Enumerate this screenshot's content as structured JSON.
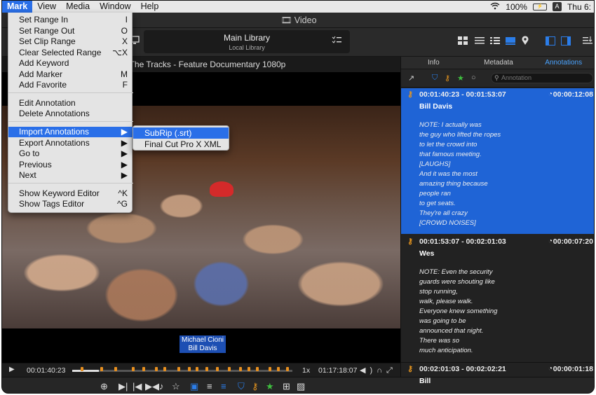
{
  "menubar": {
    "items": [
      "Mark",
      "View",
      "Media",
      "Window",
      "Help"
    ],
    "battery": "100%",
    "input_source": "A",
    "clock": "Thu 6:"
  },
  "window": {
    "title": "Video"
  },
  "toolbar": {
    "library_title": "Main Library",
    "library_subtitle": "Local Library"
  },
  "viewer": {
    "clip_title": "ff The Tracks - Feature Documentary 1080p",
    "lower_third": [
      "Michael Cioni",
      "Bill Davis"
    ]
  },
  "transport": {
    "current_timecode": "00:01:40:23",
    "speed": "1x",
    "duration_timecode": "01:17:18:07",
    "progress_fraction": 0.12
  },
  "panel": {
    "tabs": [
      "Info",
      "Metadata",
      "Annotations"
    ],
    "active_tab": "Annotations",
    "search_placeholder": "Annotation",
    "entries": [
      {
        "range": "00:01:40:23 - 00:01:53:07",
        "duration": "00:00:12:08",
        "speaker": "Bill Davis",
        "lines": [
          "NOTE: I actually was",
          "the guy who lifted the ropes",
          "to let the crowd into",
          "that famous meeting.",
          "[LAUGHS]",
          "And it was the most",
          "amazing thing because",
          "people ran",
          "to get seats.",
          "They're all crazy",
          "[CROWD NOISES]"
        ]
      },
      {
        "range": "00:01:53:07 - 00:02:01:03",
        "duration": "00:00:07:20",
        "speaker": "Wes",
        "lines": [
          "NOTE: Even the security",
          "guards were shouting like",
          "stop running,",
          "walk, please walk.",
          "Everyone knew something",
          "was going to be",
          "announced that night.",
          "There was so",
          "much anticipation."
        ]
      },
      {
        "range": "00:02:01:03 - 00:02:02:21",
        "duration": "00:00:01:18",
        "speaker": "Bill",
        "lines": []
      }
    ]
  },
  "mark_menu": {
    "items": [
      {
        "label": "Set Range In",
        "shortcut": "I"
      },
      {
        "label": "Set Range Out",
        "shortcut": "O"
      },
      {
        "label": "Set Clip Range",
        "shortcut": "X"
      },
      {
        "label": "Clear Selected Range",
        "shortcut": "⌥X"
      },
      {
        "label": "Add Keyword",
        "shortcut": ""
      },
      {
        "label": "Add Marker",
        "shortcut": "M"
      },
      {
        "label": "Add Favorite",
        "shortcut": "F"
      },
      {
        "label": "Edit Annotation",
        "shortcut": ""
      },
      {
        "label": "Delete Annotations",
        "shortcut": ""
      },
      {
        "label": "Import Annotations",
        "shortcut": "▶"
      },
      {
        "label": "Export Annotations",
        "shortcut": "▶"
      },
      {
        "label": "Go to",
        "shortcut": "▶"
      },
      {
        "label": "Previous",
        "shortcut": "▶"
      },
      {
        "label": "Next",
        "shortcut": "▶"
      },
      {
        "label": "Show Keyword Editor",
        "shortcut": "^K"
      },
      {
        "label": "Show Tags Editor",
        "shortcut": "^G"
      }
    ],
    "submenu": [
      "SubRip (.srt)",
      "Final Cut Pro X XML"
    ]
  },
  "colors": {
    "accent": "#2a6fe8",
    "selection": "#1f64d6",
    "marker": "#e8961e",
    "favorite": "#3fbf3f"
  }
}
